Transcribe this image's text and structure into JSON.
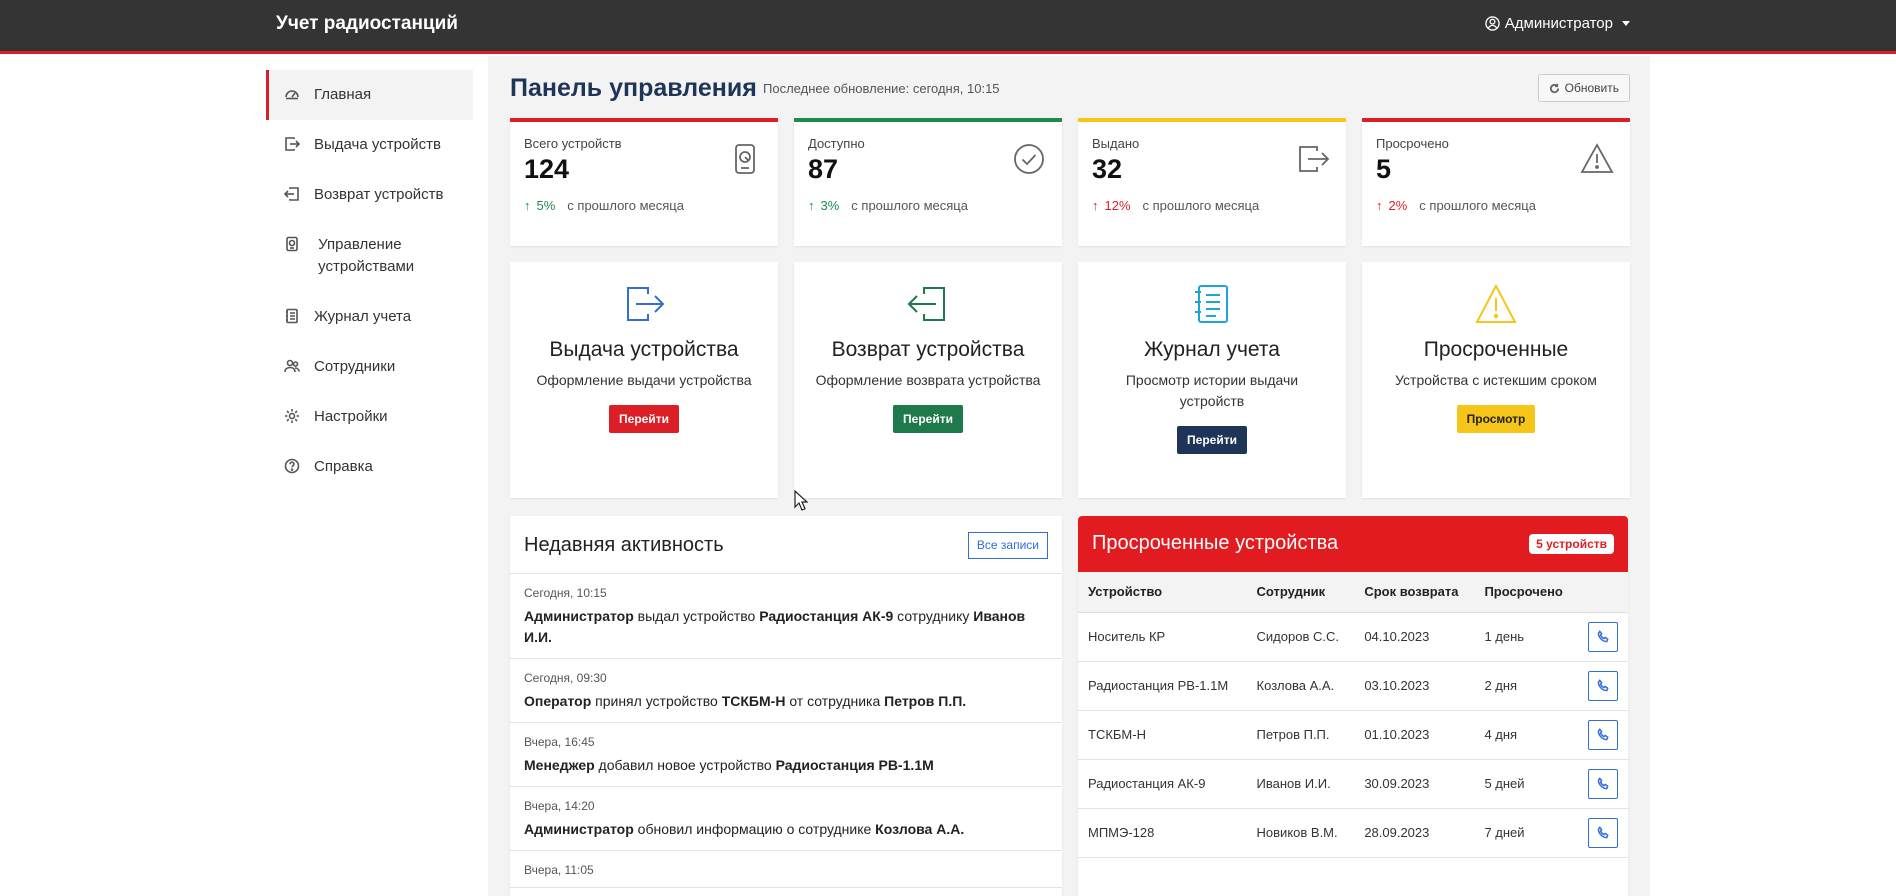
{
  "navbar": {
    "brand": "Учет радиостанций",
    "user": "Администратор"
  },
  "sidebar": {
    "items": [
      {
        "label": "Главная",
        "icon": "speedometer-icon"
      },
      {
        "label": "Выдача устройств",
        "icon": "box-arrow-right-icon"
      },
      {
        "label": "Возврат устройств",
        "icon": "box-arrow-in-left-icon"
      },
      {
        "label": "Управление устройствами",
        "icon": "device-icon"
      },
      {
        "label": "Журнал учета",
        "icon": "journal-icon"
      },
      {
        "label": "Сотрудники",
        "icon": "people-icon"
      },
      {
        "label": "Настройки",
        "icon": "gear-icon"
      },
      {
        "label": "Справка",
        "icon": "question-circle-icon"
      }
    ]
  },
  "header": {
    "title": "Панель управления",
    "last_update": "Последнее обновление: сегодня, 10:15",
    "refresh_label": "Обновить"
  },
  "stats": [
    {
      "label": "Всего устройств",
      "value": "124",
      "delta": "5%",
      "note": "с прошлого месяца",
      "color": "#dc1f26",
      "icon": "device-icon"
    },
    {
      "label": "Доступно",
      "value": "87",
      "delta": "3%",
      "note": "с прошлого месяца",
      "color": "#1e8a4e",
      "icon": "check-circle-icon"
    },
    {
      "label": "Выдано",
      "value": "32",
      "delta": "12%",
      "note": "с прошлого месяца",
      "color": "#f5c518",
      "icon": "box-arrow-right-icon"
    },
    {
      "label": "Просрочено",
      "value": "5",
      "delta": "2%",
      "note": "с прошлого месяца",
      "color": "#dc1f26",
      "icon": "warning-icon"
    }
  ],
  "actions": [
    {
      "title": "Выдача устройства",
      "desc": "Оформление выдачи устройства",
      "button": "Перейти",
      "color": "#dc1f26",
      "icon": "box-arrow-right-icon"
    },
    {
      "title": "Возврат устройства",
      "desc": "Оформление возврата устройства",
      "button": "Перейти",
      "color": "#1e7a4a",
      "icon": "box-arrow-in-left-icon"
    },
    {
      "title": "Журнал учета",
      "desc": "Просмотр истории выдачи устройств",
      "button": "Перейти",
      "color": "#1f3558",
      "icon": "journal-icon"
    },
    {
      "title": "Просроченные",
      "desc": "Устройства с истекшим сроком",
      "button": "Просмотр",
      "color": "#f5c518",
      "icon": "warning-icon"
    }
  ],
  "activity": {
    "title": "Недавняя активность",
    "all_label": "Все записи",
    "items": [
      {
        "time": "Сегодня, 10:15",
        "parts": [
          [
            "b",
            "Администратор"
          ],
          [
            "t",
            " выдал устройство "
          ],
          [
            "b",
            "Радиостанция АК-9"
          ],
          [
            "t",
            " сотруднику "
          ],
          [
            "b",
            "Иванов И.И."
          ]
        ]
      },
      {
        "time": "Сегодня, 09:30",
        "parts": [
          [
            "b",
            "Оператор"
          ],
          [
            "t",
            " принял устройство "
          ],
          [
            "b",
            "ТСКБМ-Н"
          ],
          [
            "t",
            " от сотрудника "
          ],
          [
            "b",
            "Петров П.П."
          ]
        ]
      },
      {
        "time": "Вчера, 16:45",
        "parts": [
          [
            "b",
            "Менеджер"
          ],
          [
            "t",
            " добавил новое устройство "
          ],
          [
            "b",
            "Радиостанция РВ-1.1М"
          ]
        ]
      },
      {
        "time": "Вчера, 14:20",
        "parts": [
          [
            "b",
            "Администратор"
          ],
          [
            "t",
            " обновил информацию о сотруднике "
          ],
          [
            "b",
            "Козлова А.А."
          ]
        ]
      },
      {
        "time": "Вчера, 11:05",
        "parts": []
      }
    ]
  },
  "overdue": {
    "title": "Просроченные устройства",
    "badge": "5 устройств",
    "columns": [
      "Устройство",
      "Сотрудник",
      "Срок возврата",
      "Просрочено"
    ],
    "rows": [
      [
        "Носитель КР",
        "Сидоров С.С.",
        "04.10.2023",
        "1 день"
      ],
      [
        "Радиостанция РВ-1.1М",
        "Козлова А.А.",
        "03.10.2023",
        "2 дня"
      ],
      [
        "ТСКБМ-Н",
        "Петров П.П.",
        "01.10.2023",
        "4 дня"
      ],
      [
        "Радиостанция АК-9",
        "Иванов И.И.",
        "30.09.2023",
        "5 дней"
      ],
      [
        "МПМЭ-128",
        "Новиков В.М.",
        "28.09.2023",
        "7 дней"
      ]
    ]
  }
}
